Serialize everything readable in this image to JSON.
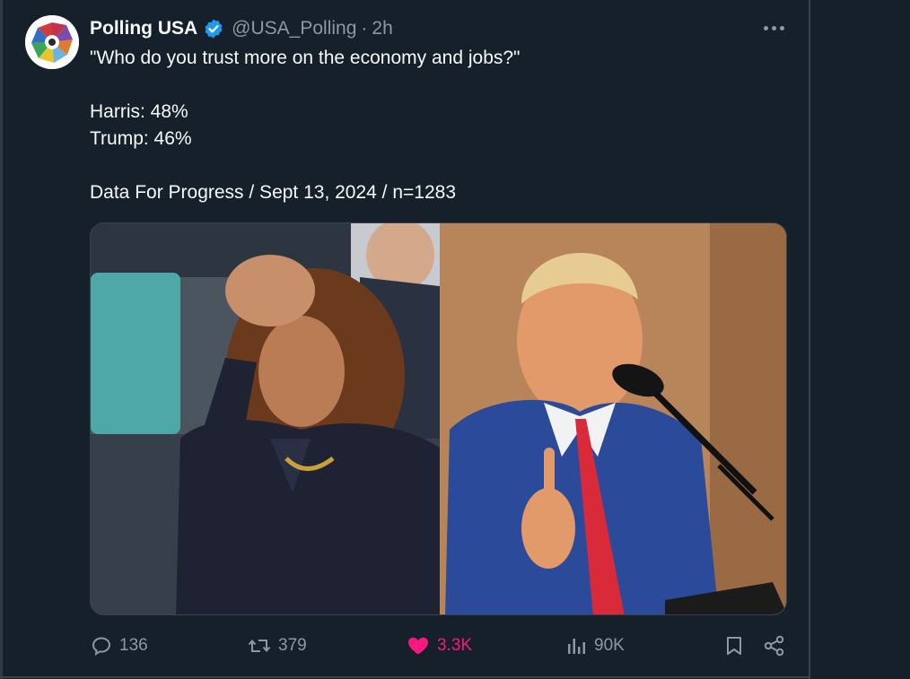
{
  "tweet": {
    "display_name": "Polling USA",
    "handle": "@USA_Polling",
    "separator": "·",
    "time": "2h",
    "lines": [
      "\"Who do you trust more on the economy and jobs?\"",
      "Harris: 48%",
      "Trump: 46%",
      "Data For Progress / Sept 13, 2024 / n=1283"
    ]
  },
  "media": {
    "left_subject": "Harris",
    "right_subject": "Trump"
  },
  "actions": {
    "replies": "136",
    "reposts": "379",
    "likes": "3.3K",
    "views": "90K"
  },
  "icons": {
    "avatar": "polling-usa-logo",
    "verified": "verified-badge-icon",
    "more": "more-icon",
    "reply": "reply-icon",
    "repost": "repost-icon",
    "like": "heart-icon",
    "views": "views-icon",
    "bookmark": "bookmark-icon",
    "share": "share-icon"
  },
  "colors": {
    "background": "#15202b",
    "text": "#f7f9f9",
    "muted": "#8b98a5",
    "verified": "#1d9bf0",
    "like": "#f91880"
  }
}
